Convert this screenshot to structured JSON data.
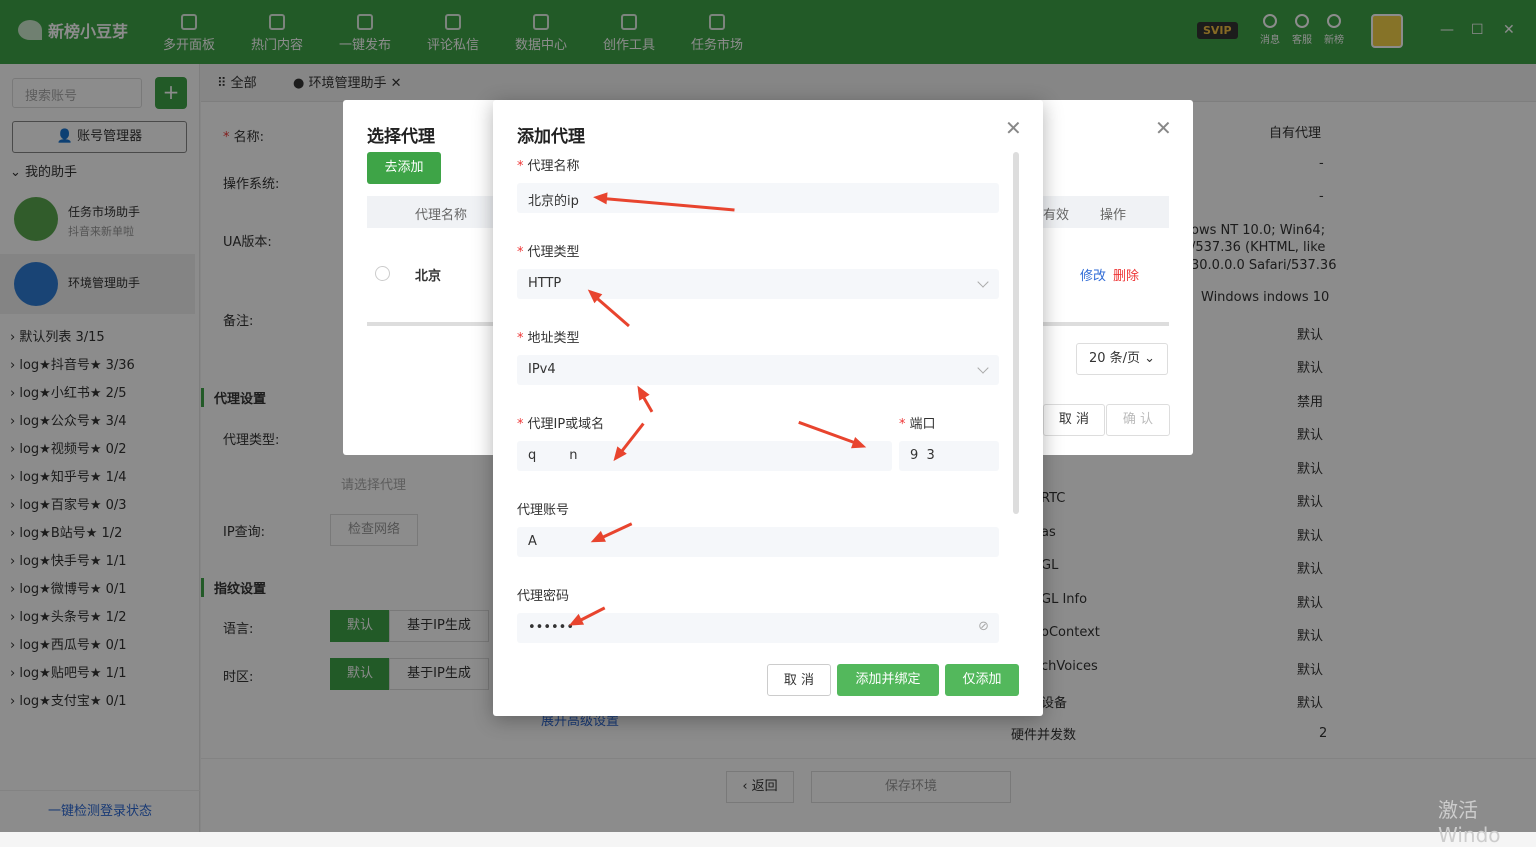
{
  "app": {
    "name": "新榜小豆芽"
  },
  "nav": [
    "多开面板",
    "热门内容",
    "一键发布",
    "评论私信",
    "数据中心",
    "创作工具",
    "任务市场"
  ],
  "topright": {
    "svip": "SVIP",
    "msg": "消息",
    "service": "客服",
    "news": "新榜"
  },
  "sidebar": {
    "search_placeholder": "搜索账号",
    "add": "+",
    "account_btn": "账号管理器",
    "my_helpers": "我的助手",
    "helpers": [
      {
        "title": "任务市场助手",
        "sub": "抖音来新单啦"
      },
      {
        "title": "环境管理助手",
        "sub": ""
      }
    ],
    "groups": [
      "默认列表 3/15",
      "log★抖音号★ 3/36",
      "log★小红书★ 2/5",
      "log★公众号★ 3/4",
      "log★视频号★ 0/2",
      "log★知乎号★ 1/4",
      "log★百家号★ 0/3",
      "log★B站号★ 1/2",
      "log★快手号★ 1/1",
      "log★微博号★ 0/1",
      "log★头条号★ 1/2",
      "log★西瓜号★ 0/1",
      "log★贴吧号★ 1/1",
      "log★支付宝★ 0/1"
    ],
    "bottom": "一键检测登录状态"
  },
  "tabs": [
    "全部",
    "环境管理助手"
  ],
  "form": {
    "name": "名称:",
    "os": "操作系统:",
    "ua": "UA版本:",
    "note": "备注:",
    "proxy_section": "代理设置",
    "proxy_type": "代理类型:",
    "choose_proxy": "请选择代理",
    "ip_query": "IP查询:",
    "check_network": "检查网络",
    "fp_section": "指纹设置",
    "lang": "语言:",
    "tz": "时区:",
    "default": "默认",
    "ip_based": "基于IP生成",
    "expand": "展开高级设置",
    "back": "返回",
    "save": "保存环境"
  },
  "right": {
    "header": "自有代理",
    "rows": [
      "-",
      "-",
      "ows NT 10.0; Win64;",
      "/537.36 (KHTML, like",
      "30.0.0.0 Safari/537.36",
      "Windows indows 10",
      "默认",
      "默认",
      "禁用",
      "默认",
      "默认",
      "默认",
      "默认",
      "默认",
      "默认",
      "默认",
      "默认",
      "默认",
      "2"
    ],
    "labels": [
      "RTC",
      "as",
      "GL",
      "GL Info",
      "oContext",
      "chVoices",
      "设备",
      "硬件并发数"
    ]
  },
  "select_dialog": {
    "title": "选择代理",
    "go_add": "去添加",
    "col_name": "代理名称",
    "col_valid": "有效",
    "col_op": "操作",
    "row_name": "北京",
    "edit": "修改",
    "delete": "删除",
    "page_size": "20 条/页",
    "cancel": "取 消",
    "confirm": "确 认"
  },
  "add_dialog": {
    "title": "添加代理",
    "f_name": "代理名称",
    "v_name": "北京的ip",
    "f_type": "代理类型",
    "v_type": "HTTP",
    "f_addr": "地址类型",
    "v_addr": "IPv4",
    "f_host": "代理IP或域名",
    "v_host": "q        n",
    "f_port": "端口",
    "v_port": "9  3",
    "f_user": "代理账号",
    "v_user": "A",
    "f_pwd": "代理密码",
    "v_pwd": "••••••",
    "cancel": "取 消",
    "add_bind": "添加并绑定",
    "add_only": "仅添加"
  },
  "watermark": "激活 Windo"
}
